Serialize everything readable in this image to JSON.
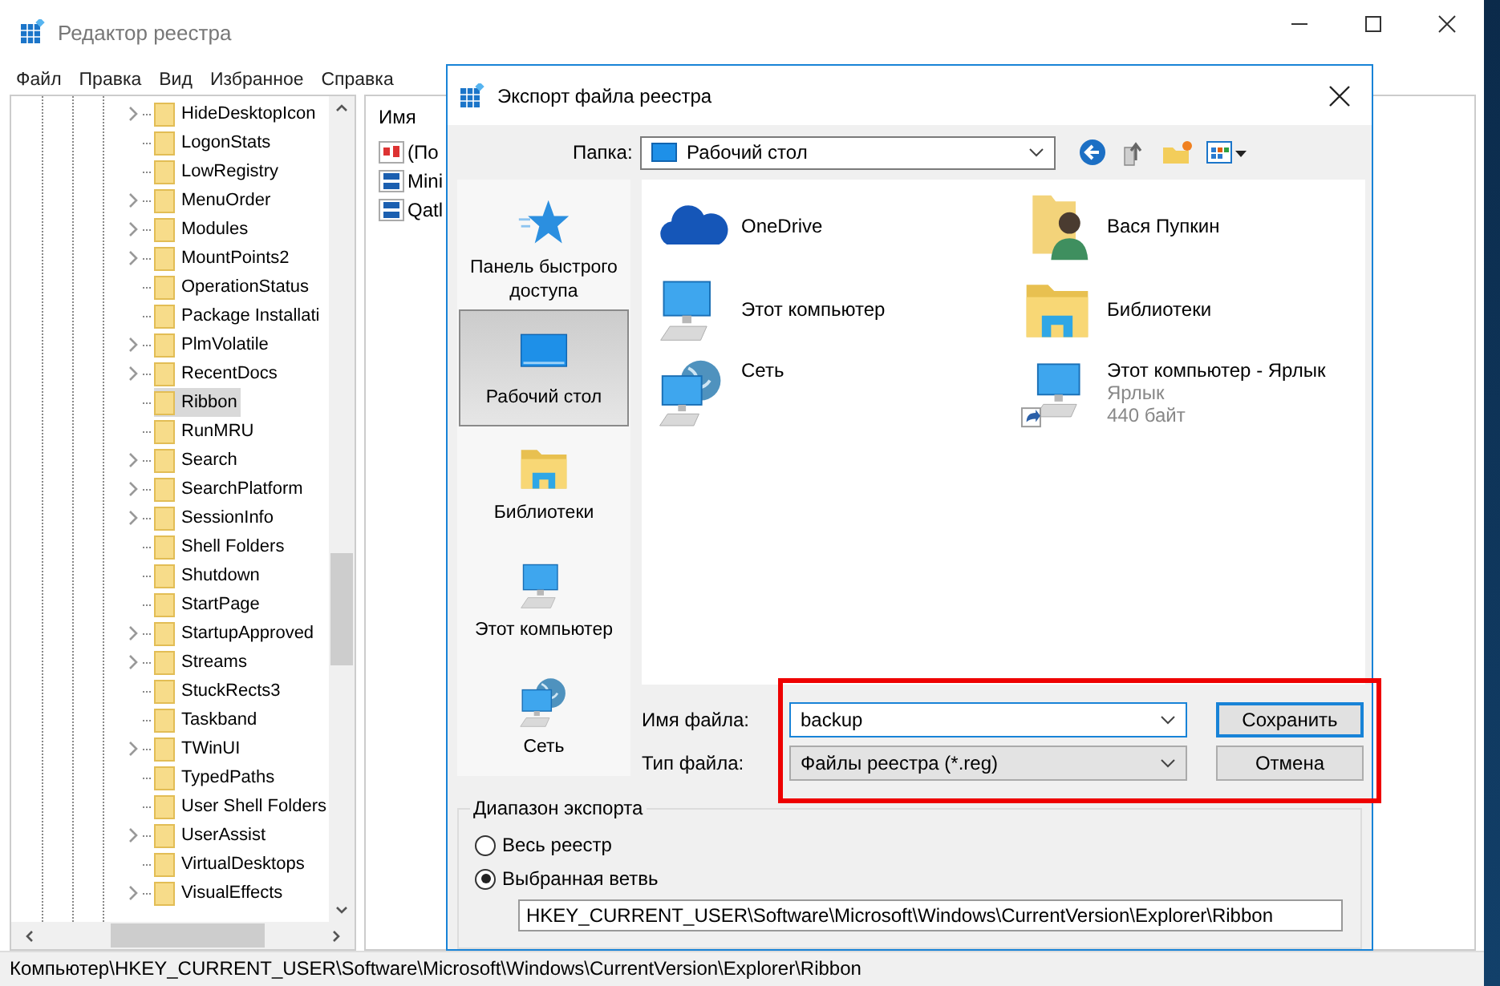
{
  "window": {
    "title": "Редактор реестра"
  },
  "menu": [
    "Файл",
    "Правка",
    "Вид",
    "Избранное",
    "Справка"
  ],
  "tree": {
    "items": [
      {
        "label": "HideDesktopIcon",
        "expandable": true,
        "selected": false
      },
      {
        "label": "LogonStats",
        "expandable": false,
        "selected": false
      },
      {
        "label": "LowRegistry",
        "expandable": false,
        "selected": false
      },
      {
        "label": "MenuOrder",
        "expandable": true,
        "selected": false
      },
      {
        "label": "Modules",
        "expandable": true,
        "selected": false
      },
      {
        "label": "MountPoints2",
        "expandable": true,
        "selected": false
      },
      {
        "label": "OperationStatus",
        "expandable": false,
        "selected": false
      },
      {
        "label": "Package Installati",
        "expandable": false,
        "selected": false
      },
      {
        "label": "PlmVolatile",
        "expandable": true,
        "selected": false
      },
      {
        "label": "RecentDocs",
        "expandable": true,
        "selected": false
      },
      {
        "label": "Ribbon",
        "expandable": false,
        "selected": true
      },
      {
        "label": "RunMRU",
        "expandable": false,
        "selected": false
      },
      {
        "label": "Search",
        "expandable": true,
        "selected": false
      },
      {
        "label": "SearchPlatform",
        "expandable": true,
        "selected": false
      },
      {
        "label": "SessionInfo",
        "expandable": true,
        "selected": false
      },
      {
        "label": "Shell Folders",
        "expandable": false,
        "selected": false
      },
      {
        "label": "Shutdown",
        "expandable": false,
        "selected": false
      },
      {
        "label": "StartPage",
        "expandable": false,
        "selected": false
      },
      {
        "label": "StartupApproved",
        "expandable": true,
        "selected": false
      },
      {
        "label": "Streams",
        "expandable": true,
        "selected": false
      },
      {
        "label": "StuckRects3",
        "expandable": false,
        "selected": false
      },
      {
        "label": "Taskband",
        "expandable": false,
        "selected": false
      },
      {
        "label": "TWinUI",
        "expandable": true,
        "selected": false
      },
      {
        "label": "TypedPaths",
        "expandable": false,
        "selected": false
      },
      {
        "label": "User Shell Folders",
        "expandable": false,
        "selected": false
      },
      {
        "label": "UserAssist",
        "expandable": true,
        "selected": false
      },
      {
        "label": "VirtualDesktops",
        "expandable": false,
        "selected": false
      },
      {
        "label": "VisualEffects",
        "expandable": true,
        "selected": false
      }
    ]
  },
  "values_pane": {
    "column": "Имя",
    "rows": [
      {
        "name": "(По",
        "kind": "string"
      },
      {
        "name": "Mini",
        "kind": "binary"
      },
      {
        "name": "Qatl",
        "kind": "binary"
      }
    ]
  },
  "status_bar": "Компьютер\\HKEY_CURRENT_USER\\Software\\Microsoft\\Windows\\CurrentVersion\\Explorer\\Ribbon",
  "dialog": {
    "title": "Экспорт файла реестра",
    "folder_label": "Папка:",
    "folder_value": "Рабочий стол",
    "places": [
      {
        "label": "Панель быстрого доступа",
        "kind": "star",
        "selected": false
      },
      {
        "label": "Рабочий стол",
        "kind": "desktop",
        "selected": true
      },
      {
        "label": "Библиотеки",
        "kind": "library",
        "selected": false
      },
      {
        "label": "Этот компьютер",
        "kind": "pc",
        "selected": false
      },
      {
        "label": "Сеть",
        "kind": "network",
        "selected": false
      }
    ],
    "files": [
      {
        "name": "OneDrive",
        "kind": "cloud"
      },
      {
        "name": "Вася Пупкин",
        "kind": "person"
      },
      {
        "name": "Этот компьютер",
        "kind": "pc"
      },
      {
        "name": "Библиотеки",
        "kind": "library"
      },
      {
        "name": "Сеть",
        "kind": "network"
      },
      {
        "name": "Этот компьютер - Ярлык",
        "kind": "shortcut",
        "details": [
          "Ярлык",
          "440 байт"
        ]
      }
    ],
    "file_name_label": "Имя файла:",
    "file_name": "backup",
    "file_type_label": "Тип файла:",
    "file_type": "Файлы реестра (*.reg)",
    "buttons": [
      "Сохранить",
      "Отмена"
    ],
    "range": {
      "title": "Диапазон экспорта",
      "options": [
        {
          "label": "Весь реестр",
          "selected": false
        },
        {
          "label": "Выбранная ветвь",
          "selected": true
        }
      ],
      "branch": "HKEY_CURRENT_USER\\Software\\Microsoft\\Windows\\CurrentVersion\\Explorer\\Ribbon"
    }
  }
}
